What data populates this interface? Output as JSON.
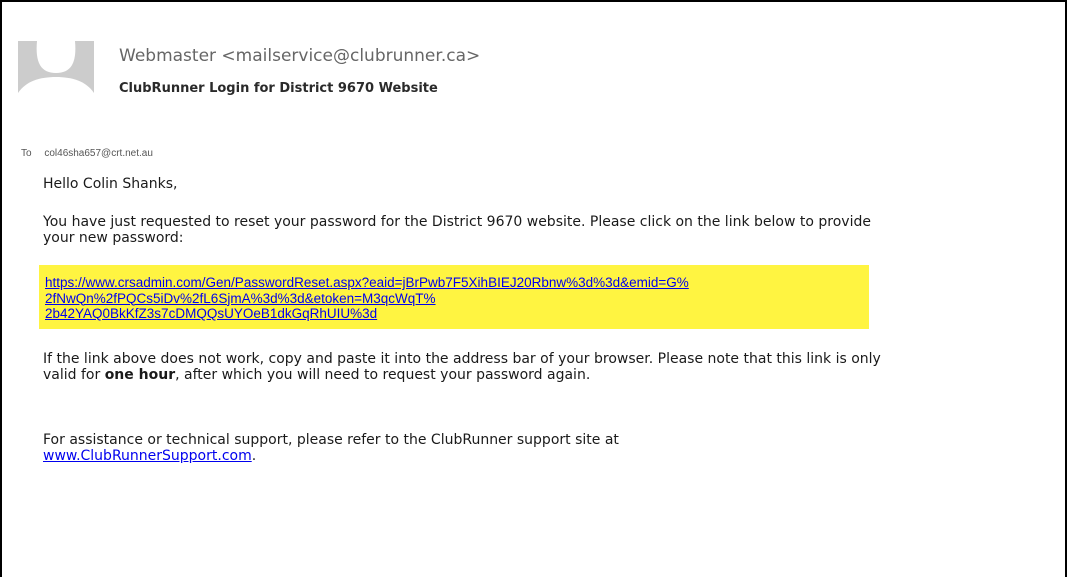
{
  "email": {
    "sender": "Webmaster <mailservice@clubrunner.ca>",
    "subject": "ClubRunner Login for District 9670 Website",
    "to_label": "To",
    "recipient": "col46sha657@crt.net.au"
  },
  "body": {
    "greeting": "Hello Colin Shanks,",
    "paragraph1": "You have just requested to reset your password for the District 9670 website. Please click on the link below to provide your new password:",
    "reset_link": {
      "line1": "https://www.crsadmin.com/Gen/PasswordReset.aspx?eaid=jBrPwb7F5XihBIEJ20Rbnw%3d%3d&emid=G%",
      "line2": "2fNwQn%2fPQCs5iDv%2fL6SjmA%3d%3d&etoken=M3qcWqT%",
      "line3": "2b42YAQ0BkKfZ3s7cDMQQsUYOeB1dkGqRhUIU%3d"
    },
    "paragraph2_start": "If the link above does not work, copy and paste it into the address bar of your browser. Please note that this link is only valid for ",
    "paragraph2_bold": "one hour",
    "paragraph2_end": ", after which you will need to request your password again.",
    "paragraph3_text": "For assistance or technical support, please refer to the ClubRunner support site at ",
    "support_link": "www.ClubRunnerSupport.com",
    "paragraph3_end": "."
  },
  "colors": {
    "highlight": "#fff441",
    "link": "#0000ee",
    "avatar_bg": "#cccccc"
  },
  "icons": {
    "avatar": "person-silhouette-icon"
  }
}
